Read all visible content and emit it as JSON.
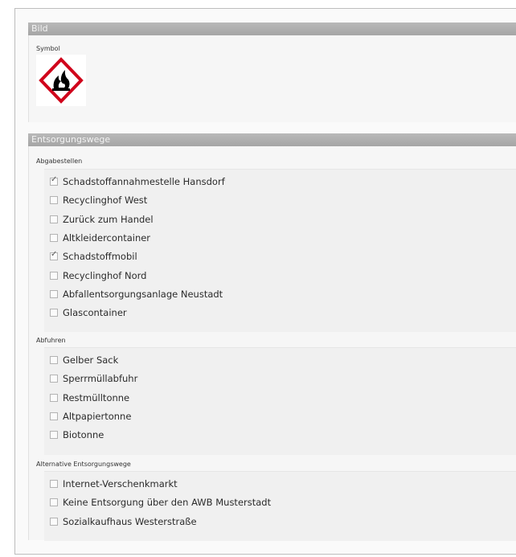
{
  "sections": {
    "bild": {
      "title": "Bild",
      "symbol_label": "Symbol",
      "symbol_icon": "ghs-flammable-icon"
    },
    "entsorgung": {
      "title": "Entsorgungswege"
    }
  },
  "groups": [
    {
      "label": "Abgabestellen",
      "items": [
        {
          "label": "Schadstoffannahmestelle Hansdorf",
          "checked": true
        },
        {
          "label": "Recyclinghof West",
          "checked": false
        },
        {
          "label": "Zurück zum Handel",
          "checked": false
        },
        {
          "label": "Altkleidercontainer",
          "checked": false
        },
        {
          "label": "Schadstoffmobil",
          "checked": true
        },
        {
          "label": "Recyclinghof Nord",
          "checked": false
        },
        {
          "label": "Abfallentsorgungsanlage Neustadt",
          "checked": false
        },
        {
          "label": "Glascontainer",
          "checked": false
        }
      ]
    },
    {
      "label": "Abfuhren",
      "items": [
        {
          "label": "Gelber Sack",
          "checked": false
        },
        {
          "label": "Sperrmüllabfuhr",
          "checked": false
        },
        {
          "label": "Restmülltonne",
          "checked": false
        },
        {
          "label": "Altpapiertonne",
          "checked": false
        },
        {
          "label": "Biotonne",
          "checked": false
        }
      ]
    },
    {
      "label": "Alternative Entsorgungswege",
      "items": [
        {
          "label": "Internet-Verschenkmarkt",
          "checked": false
        },
        {
          "label": "Keine Entsorgung über den AWB Musterstadt",
          "checked": false
        },
        {
          "label": "Sozialkaufhaus Westerstraße",
          "checked": false
        }
      ]
    }
  ],
  "colors": {
    "header_bg": "#aaaaaa",
    "pictogram_border": "#d0021b"
  }
}
